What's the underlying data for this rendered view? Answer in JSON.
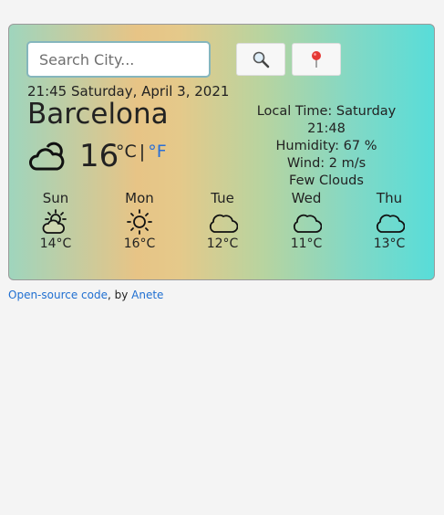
{
  "search": {
    "placeholder": "Search City..."
  },
  "buttons": {
    "search_icon": "magnifier-icon",
    "location_icon": "pin-icon"
  },
  "current": {
    "datetime": "21:45 Saturday, April 3, 2021",
    "city": "Barcelona",
    "temp": "16",
    "unit_c": "°C",
    "separator": "|",
    "unit_f": "°F",
    "icon": "cloudy-icon"
  },
  "details": {
    "local_time_line1": "Local Time: Saturday",
    "local_time_line2": "21:48",
    "humidity": "Humidity: 67 %",
    "wind": "Wind: 2 m/s",
    "description": "Few Clouds"
  },
  "forecast": [
    {
      "day": "Sun",
      "temp": "14°C",
      "icon": "partly-sunny-icon"
    },
    {
      "day": "Mon",
      "temp": "16°C",
      "icon": "sun-icon"
    },
    {
      "day": "Tue",
      "temp": "12°C",
      "icon": "cloud-icon"
    },
    {
      "day": "Wed",
      "temp": "11°C",
      "icon": "cloud-icon"
    },
    {
      "day": "Thu",
      "temp": "13°C",
      "icon": "cloud-icon"
    }
  ],
  "footer": {
    "link1": "Open-source code",
    "between": ", by ",
    "link2": "Anete"
  },
  "colors": {
    "link": "#1f6fd1",
    "unit_active": "#2a6fd6"
  }
}
